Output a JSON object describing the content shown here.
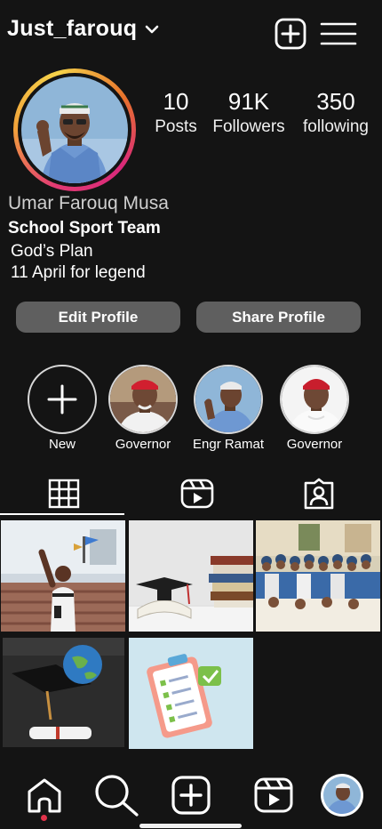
{
  "header": {
    "username": "Just_farouq",
    "icons": [
      "chevron-down-icon",
      "new-post-icon",
      "menu-icon"
    ]
  },
  "profile": {
    "stats": {
      "posts_count": "10",
      "posts_label": "Posts",
      "followers_count": "91K",
      "followers_label": "Followers",
      "following_count": "350",
      "following_label": "following"
    },
    "full_name": "Umar Farouq Musa",
    "category": "School Sport Team",
    "bio_lines": [
      "God’s Plan",
      "11 April for legend"
    ]
  },
  "actions": {
    "edit_label": "Edit Profile",
    "share_label": "Share Profile"
  },
  "highlights": [
    {
      "label": "New",
      "icon": "plus-icon"
    },
    {
      "label": "Governor"
    },
    {
      "label": "Engr Ramat"
    },
    {
      "label": "Governor"
    }
  ],
  "tabs": [
    {
      "icon": "grid-icon",
      "active": true
    },
    {
      "icon": "reels-icon"
    },
    {
      "icon": "tagged-icon"
    }
  ],
  "nav": [
    "home-icon",
    "search-icon",
    "create-icon",
    "reels-icon",
    "profile-avatar"
  ],
  "colors": {
    "background": "#141414",
    "button": "#5f5f5f",
    "notification_dot": "#e2334b"
  }
}
